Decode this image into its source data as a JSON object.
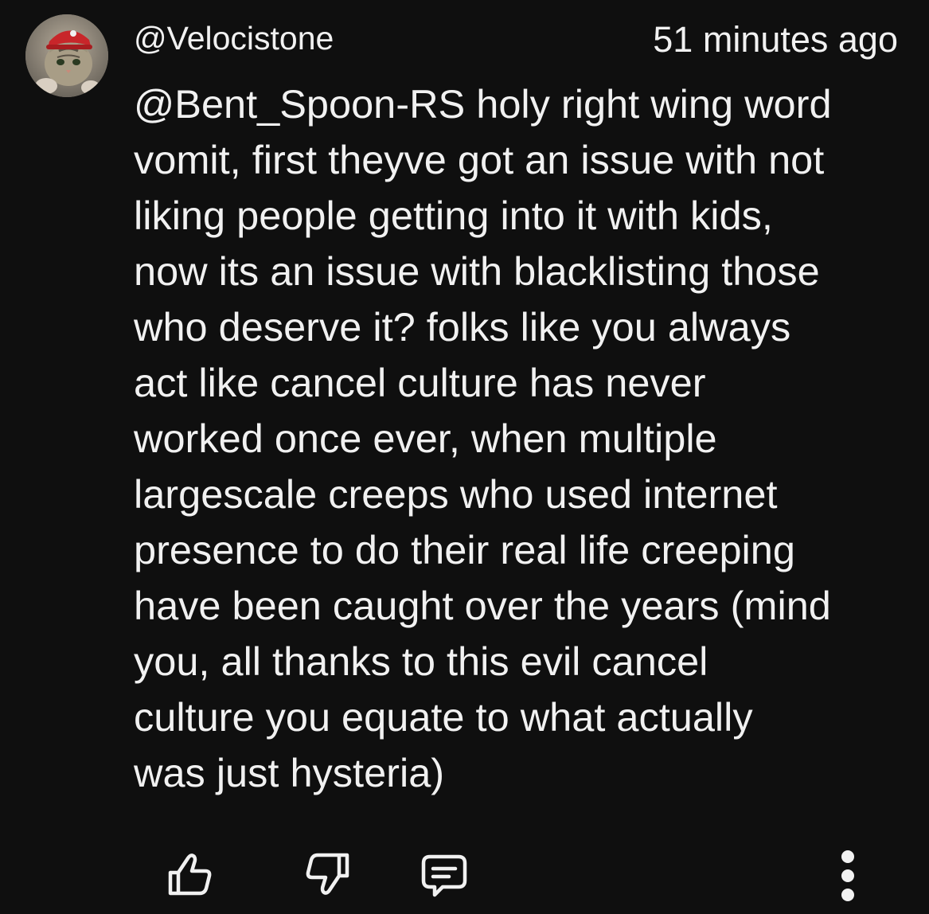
{
  "comment": {
    "author": "@Velocistone",
    "timestamp": "51 minutes ago",
    "body_lines": [
      "@Bent_Spoon-RS holy right wing word",
      "vomit, first theyve got an issue with not",
      "liking people getting into it with kids,",
      "now its an issue with blacklisting those",
      "who deserve it? folks like you always",
      "act like cancel culture has never",
      "worked once ever, when multiple",
      "largescale creeps who used internet",
      "presence to do their real life creeping",
      "have been caught over the years (mind",
      "you, all thanks to this evil cancel",
      "culture you equate to what actually",
      "was just hysteria)"
    ]
  },
  "actions": {
    "like_icon": "thumbs-up-icon",
    "dislike_icon": "thumbs-down-icon",
    "reply_icon": "comment-icon",
    "more_icon": "more-vertical-icon"
  },
  "colors": {
    "background": "#0f0f0f",
    "text": "#f1f1f1"
  }
}
